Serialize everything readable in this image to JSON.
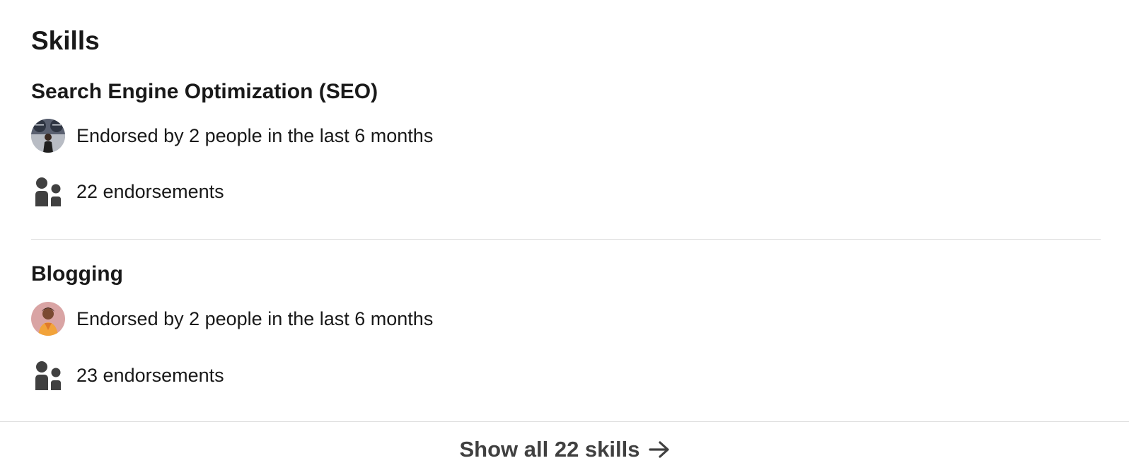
{
  "section": {
    "title": "Skills"
  },
  "skills": [
    {
      "name": "Search Engine Optimization (SEO)",
      "endorsed_text": "Endorsed by 2 people in the last 6 months",
      "endorsements_text": "22 endorsements",
      "avatar_icon": "endorser-avatar-photo"
    },
    {
      "name": "Blogging",
      "endorsed_text": "Endorsed by 2 people in the last 6 months",
      "endorsements_text": "23 endorsements",
      "avatar_icon": "endorser-avatar-photo"
    }
  ],
  "footer": {
    "show_all_label": "Show all 22 skills",
    "arrow_icon": "arrow-right-icon"
  },
  "colors": {
    "text": "#191919",
    "divider": "#dedede",
    "icon": "#404040",
    "footer_text": "#404040"
  }
}
